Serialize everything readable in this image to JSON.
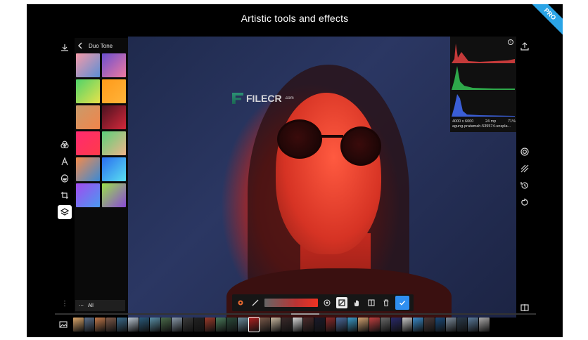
{
  "title": "Artistic tools and effects",
  "badge": "PRO",
  "panel": {
    "back_icon": "chevron-left-icon",
    "header": "Duo Tone",
    "swatches": [
      {
        "name": "swatch-pink-blue",
        "from": "#f59aa8",
        "to": "#5b8fd6"
      },
      {
        "name": "swatch-purple-pink",
        "from": "#6a4fcf",
        "to": "#f07aa0"
      },
      {
        "name": "swatch-green-yellow",
        "from": "#4fd36a",
        "to": "#e8e24a"
      },
      {
        "name": "swatch-orange",
        "from": "#ff9a1a",
        "to": "#ffb43a"
      },
      {
        "name": "swatch-tan-orange",
        "from": "#c99a6a",
        "to": "#f2854a"
      },
      {
        "name": "swatch-dark-red",
        "from": "#4a1220",
        "to": "#d5283a"
      },
      {
        "name": "swatch-pink-red",
        "from": "#ff2a70",
        "to": "#ff3a4a"
      },
      {
        "name": "swatch-green-peach",
        "from": "#5ad07a",
        "to": "#f0b48a"
      },
      {
        "name": "swatch-orange-blue",
        "from": "#f58a4a",
        "to": "#3a8ad6"
      },
      {
        "name": "swatch-blue-cyan",
        "from": "#2a6ef0",
        "to": "#5ae0f0"
      },
      {
        "name": "swatch-violet-blue",
        "from": "#a24af0",
        "to": "#4a9af0"
      },
      {
        "name": "swatch-lime-purple",
        "from": "#9ae04a",
        "to": "#8a4ad6"
      }
    ],
    "footer_dots": "⋯",
    "footer_label": "All"
  },
  "histogram": {
    "resolution": "4000 x 6000",
    "megapixels": "24 mp",
    "zoom": "71%",
    "filename": "agung-pratamah-539574-unspla..."
  },
  "watermark": {
    "text": "FILECR",
    "sub": ".com"
  },
  "colors": {
    "accent": "#2f8ff0",
    "pro_badge": "#2aa4e6"
  },
  "filmstrip": {
    "gallery_icon": "gallery-icon",
    "thumbnails": [
      "#d9a56a",
      "#5a6f8a",
      "#c0784a",
      "#7d5a4a",
      "#3a6a8a",
      "#b8c4d0",
      "#2a5a7a",
      "#5a8fa6",
      "#4a6a4a",
      "#8a9aaa",
      "#3a3a3a",
      "#222",
      "#9a3a2a",
      "#4a7a5a",
      "#2a4a3a",
      "#6a8a9a",
      "#b02020",
      "#7a5a4a",
      "#c8b8a0",
      "#3a2a2a",
      "#d8d8d8",
      "#4a2a2a",
      "#1a1a2a",
      "#8a2a2a",
      "#4a6a9a",
      "#3a9ac8",
      "#d0a070",
      "#c04040",
      "#6a6a6a",
      "#2a2a6a",
      "#c8c8c8",
      "#3a8ac8",
      "#4a3a3a",
      "#1a4a7a",
      "#7a8a9a",
      "#2a3a4a",
      "#5a7a9a",
      "#aaa8a8"
    ]
  }
}
